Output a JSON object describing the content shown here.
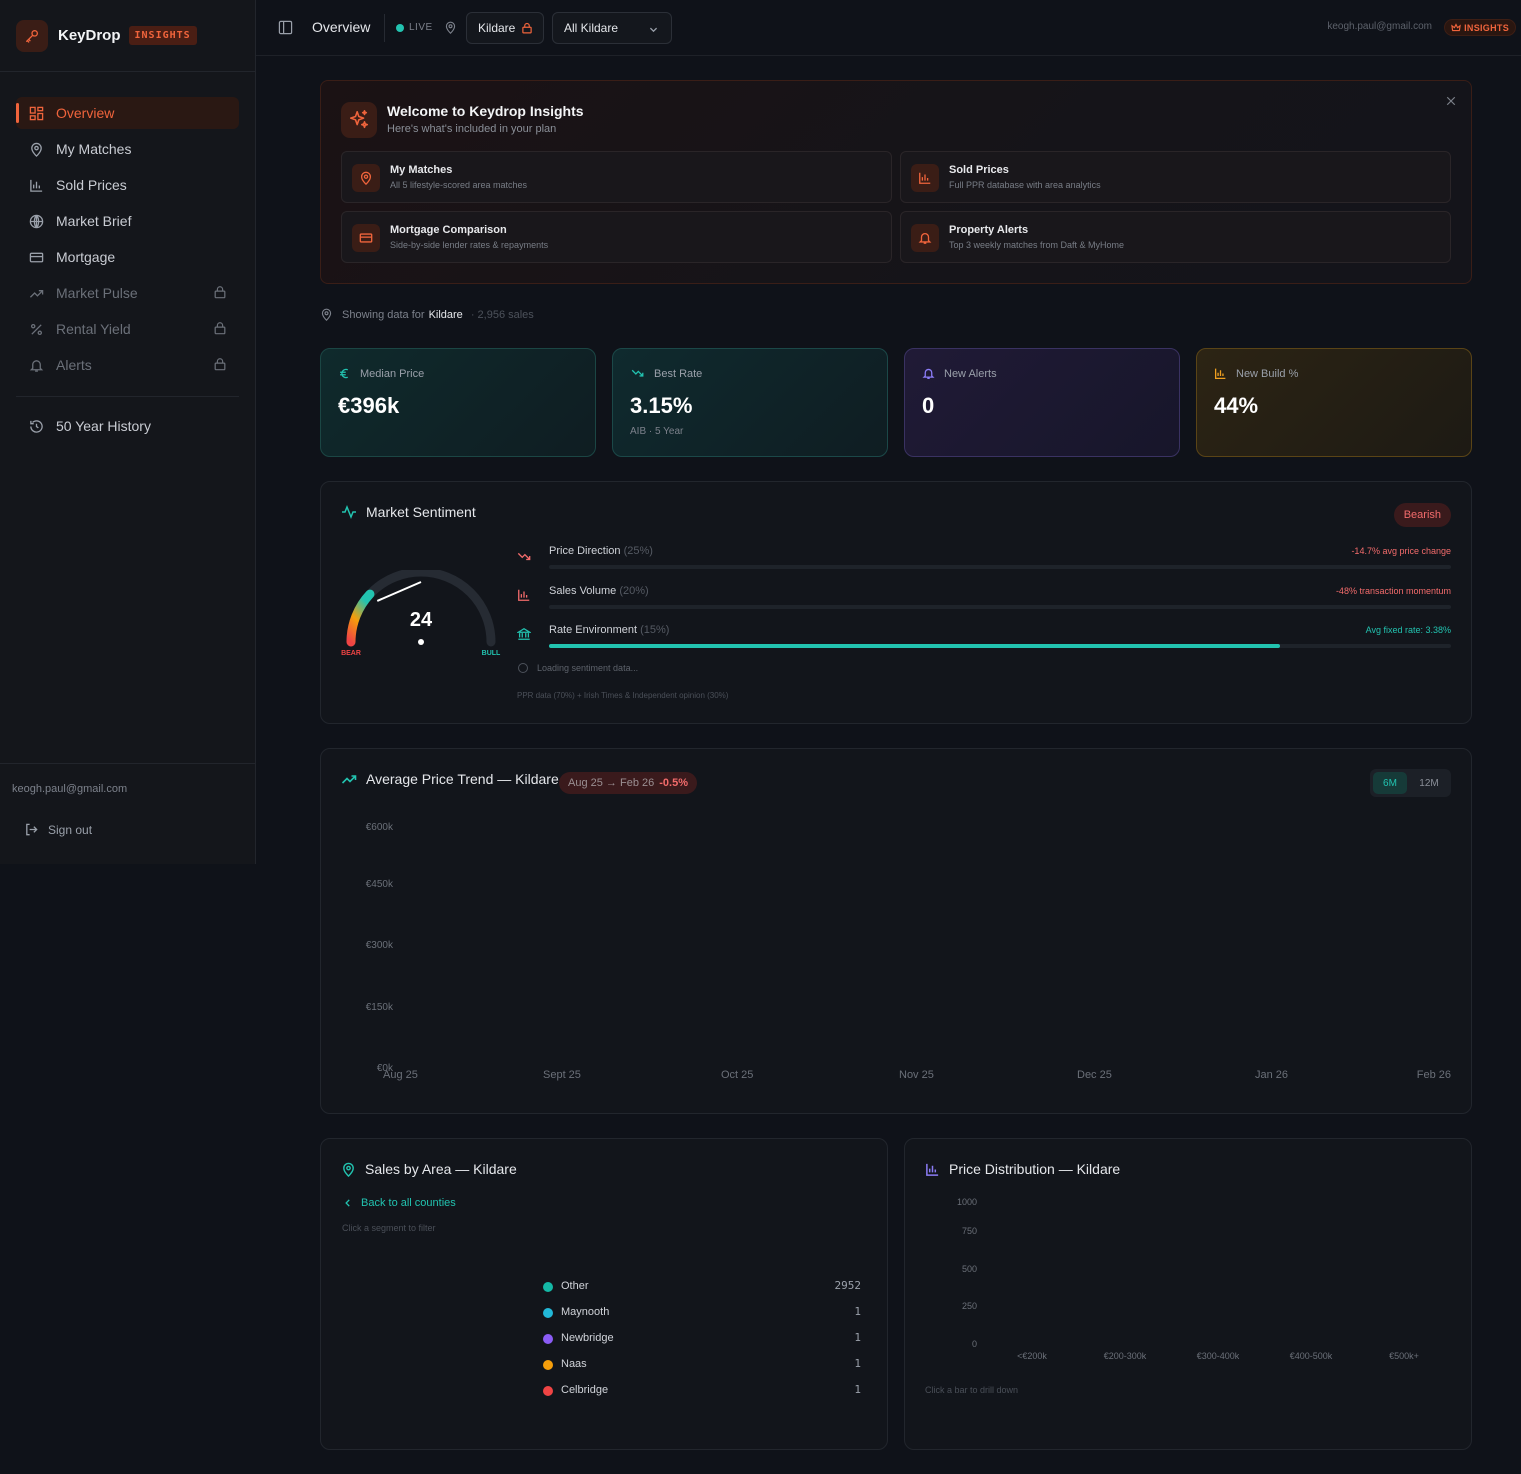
{
  "brand": {
    "name": "KeyDrop",
    "badge": "INSIGHTS"
  },
  "sidebar": {
    "items": [
      {
        "label": "Overview",
        "icon": "grid-icon",
        "active": true,
        "locked": false
      },
      {
        "label": "My Matches",
        "icon": "map-pin-icon",
        "active": false,
        "locked": false
      },
      {
        "label": "Sold Prices",
        "icon": "bar-chart-icon",
        "active": false,
        "locked": false
      },
      {
        "label": "Market Brief",
        "icon": "globe-icon",
        "active": false,
        "locked": false
      },
      {
        "label": "Mortgage",
        "icon": "credit-card-icon",
        "active": false,
        "locked": false
      },
      {
        "label": "Market Pulse",
        "icon": "trending-up-icon",
        "active": false,
        "locked": true
      },
      {
        "label": "Rental Yield",
        "icon": "percent-icon",
        "active": false,
        "locked": true
      },
      {
        "label": "Alerts",
        "icon": "bell-icon",
        "active": false,
        "locked": true
      }
    ],
    "history": {
      "label": "50 Year History",
      "icon": "history-icon"
    },
    "email": "keogh.paul@gmail.com",
    "signout": "Sign out"
  },
  "topbar": {
    "title": "Overview",
    "live": "LIVE",
    "county": "Kildare",
    "area": "All Kildare",
    "email": "keogh.paul@gmail.com",
    "badge": "INSIGHTS"
  },
  "welcome": {
    "title": "Welcome to Keydrop Insights",
    "subtitle": "Here's what's included in your plan",
    "features": [
      {
        "title": "My Matches",
        "desc": "All 5 lifestyle-scored area matches",
        "icon": "map-pin-icon"
      },
      {
        "title": "Sold Prices",
        "desc": "Full PPR database with area analytics",
        "icon": "bar-chart-icon"
      },
      {
        "title": "Mortgage Comparison",
        "desc": "Side-by-side lender rates & repayments",
        "icon": "credit-card-icon"
      },
      {
        "title": "Property Alerts",
        "desc": "Top 3 weekly matches from Daft & MyHome",
        "icon": "bell-icon"
      }
    ]
  },
  "showing": {
    "prefix": "Showing data for",
    "county": "Kildare",
    "count": "· 2,956 sales"
  },
  "stats": [
    {
      "label": "Median Price",
      "value": "€396k",
      "sub": "",
      "icon": "euro-icon",
      "color": "#22c3b0"
    },
    {
      "label": "Best Rate",
      "value": "3.15%",
      "sub": "AIB · 5 Year",
      "icon": "trending-down-icon",
      "color": "#22c3b0"
    },
    {
      "label": "New Alerts",
      "value": "0",
      "sub": "",
      "icon": "bell-icon",
      "color": "#8b7cf6"
    },
    {
      "label": "New Build %",
      "value": "44%",
      "sub": "",
      "icon": "bar-chart-icon",
      "color": "#f0a020"
    }
  ],
  "sentiment": {
    "title": "Market Sentiment",
    "badge": "Bearish",
    "score": "24",
    "score_value": 24,
    "bear_label": "BEAR",
    "bull_label": "BULL",
    "metrics": [
      {
        "label": "Price Direction",
        "weight": "(25%)",
        "right": "-14.7% avg price change",
        "color": "#f26b6b",
        "fill": 0,
        "icon": "trending-down-icon"
      },
      {
        "label": "Sales Volume",
        "weight": "(20%)",
        "right": "-48% transaction momentum",
        "color": "#f26b6b",
        "fill": 0,
        "icon": "bar-chart-icon"
      },
      {
        "label": "Rate Environment",
        "weight": "(15%)",
        "right": "Avg fixed rate: 3.38%",
        "color": "#22c3b0",
        "fill": 0.81,
        "icon": "bank-icon"
      }
    ],
    "loading": "Loading sentiment data...",
    "source": "PPR data (70%) + Irish Times & Independent opinion (30%)"
  },
  "trend": {
    "title": "Average Price Trend — Kildare",
    "range": "Aug 25 → Feb 26",
    "change": "-0.5%",
    "toggle_6m": "6M",
    "toggle_12m": "12M"
  },
  "sales_area": {
    "title": "Sales by Area — Kildare",
    "back": "Back to all counties",
    "hint": "Click a segment to filter"
  },
  "price_dist": {
    "title": "Price Distribution — Kildare",
    "hint": "Click a bar to drill down"
  },
  "chart_data": [
    {
      "type": "line",
      "title": "Average Price Trend — Kildare",
      "x": [
        "Aug 25",
        "Sept 25",
        "Oct 25",
        "Nov 25",
        "Dec 25",
        "Jan 26",
        "Feb 26"
      ],
      "y_ticks": [
        "€600k",
        "€450k",
        "€300k",
        "€150k",
        "€0k"
      ],
      "series": [],
      "ylim": [
        0,
        600000
      ]
    },
    {
      "type": "pie",
      "title": "Sales by Area — Kildare",
      "categories": [
        "Other",
        "Maynooth",
        "Newbridge",
        "Naas",
        "Celbridge"
      ],
      "values": [
        2952,
        1,
        1,
        1,
        1
      ],
      "colors": [
        "#14b8a6",
        "#22b8d8",
        "#8b5cf6",
        "#f59e0b",
        "#ef4444"
      ]
    },
    {
      "type": "bar",
      "title": "Price Distribution — Kildare",
      "categories": [
        "<€200k",
        "€200-300k",
        "€300-400k",
        "€400-500k",
        "€500k+"
      ],
      "y_ticks": [
        "1000",
        "750",
        "500",
        "250",
        "0"
      ],
      "ylim": [
        0,
        1000
      ],
      "values": []
    }
  ]
}
